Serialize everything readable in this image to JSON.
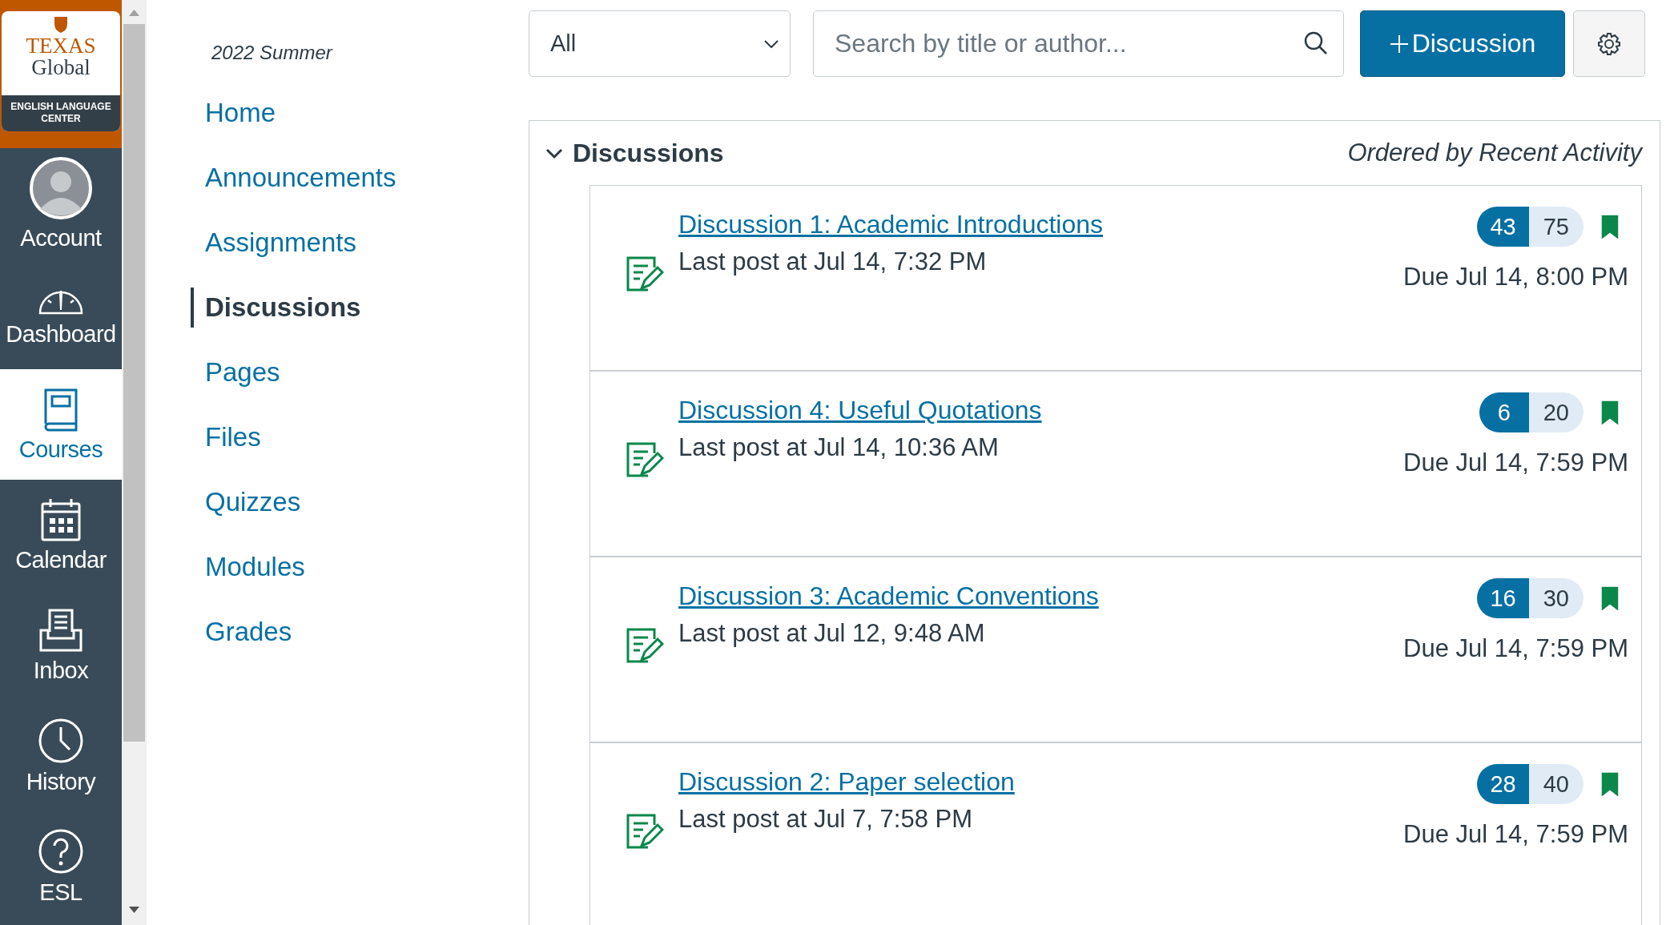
{
  "global_nav": {
    "logo": {
      "line1": "TEXAS",
      "line2": "Global",
      "subtitle": "ENGLISH LANGUAGE CENTER"
    },
    "items": [
      {
        "label": "Account",
        "selected": false
      },
      {
        "label": "Dashboard",
        "selected": false
      },
      {
        "label": "Courses",
        "selected": true
      },
      {
        "label": "Calendar",
        "selected": false
      },
      {
        "label": "Inbox",
        "selected": false
      },
      {
        "label": "History",
        "selected": false
      },
      {
        "label": "ESL",
        "selected": false
      }
    ]
  },
  "course_nav": {
    "term": "2022 Summer",
    "items": [
      {
        "label": "Home",
        "selected": false
      },
      {
        "label": "Announcements",
        "selected": false
      },
      {
        "label": "Assignments",
        "selected": false
      },
      {
        "label": "Discussions",
        "selected": true
      },
      {
        "label": "Pages",
        "selected": false
      },
      {
        "label": "Files",
        "selected": false
      },
      {
        "label": "Quizzes",
        "selected": false
      },
      {
        "label": "Modules",
        "selected": false
      },
      {
        "label": "Grades",
        "selected": false
      }
    ]
  },
  "toolbar": {
    "filter": {
      "value": "All"
    },
    "search": {
      "placeholder": "Search by title or author..."
    },
    "new_button": {
      "label": "Discussion"
    }
  },
  "discussions": {
    "title": "Discussions",
    "expanded": true,
    "order_note": "Ordered by Recent Activity",
    "items": [
      {
        "title": "Discussion 1: Academic Introductions",
        "last_post": "Last post at Jul 14, 7:32 PM",
        "unread": "43",
        "total": "75",
        "subscribed": true,
        "due": "Due Jul 14, 8:00 PM"
      },
      {
        "title": "Discussion 4: Useful Quotations",
        "last_post": "Last post at Jul 14, 10:36 AM",
        "unread": "6",
        "total": "20",
        "subscribed": true,
        "due": "Due Jul 14, 7:59 PM"
      },
      {
        "title": "Discussion 3: Academic Conventions",
        "last_post": "Last post at Jul 12, 9:48 AM",
        "unread": "16",
        "total": "30",
        "subscribed": true,
        "due": "Due Jul 14, 7:59 PM"
      },
      {
        "title": "Discussion 2: Paper selection",
        "last_post": "Last post at Jul 7, 7:58 PM",
        "unread": "28",
        "total": "40",
        "subscribed": true,
        "due": "Due Jul 14, 7:59 PM"
      }
    ]
  }
}
